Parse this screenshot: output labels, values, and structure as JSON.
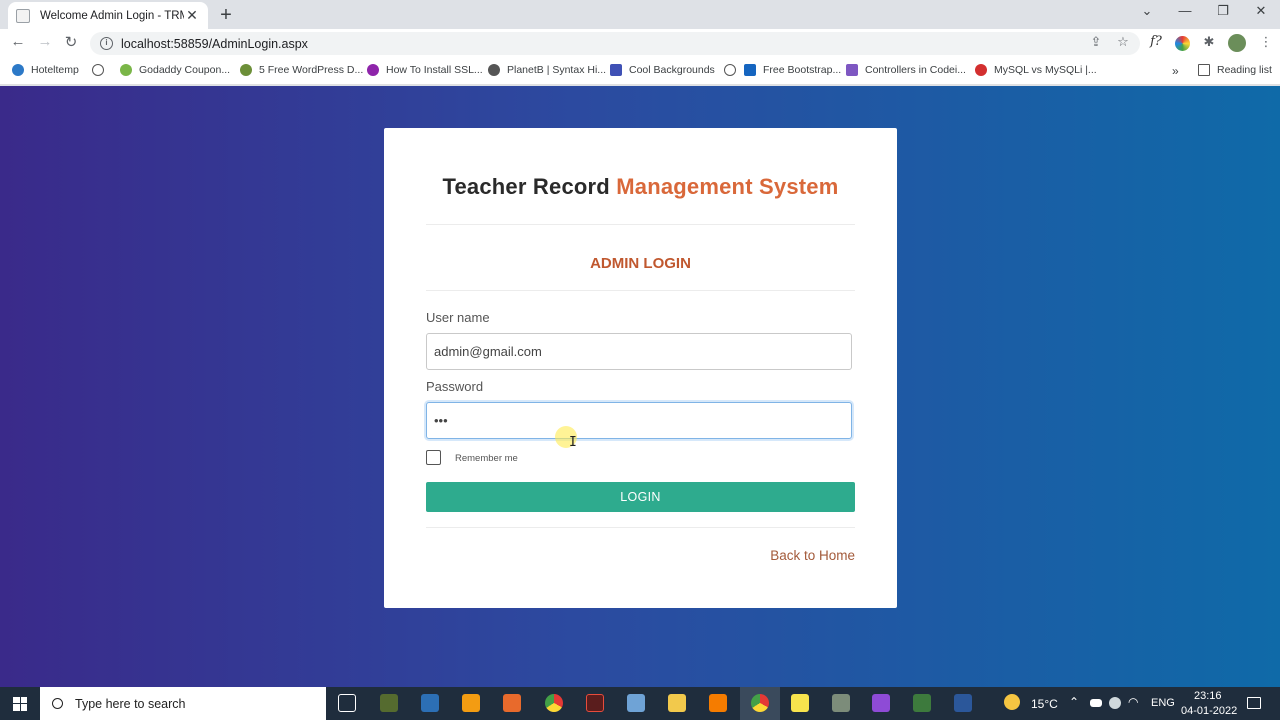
{
  "browser": {
    "tab_title": "Welcome Admin Login - TRMS-",
    "url": "localhost:58859/AdminLogin.aspx",
    "new_tab": "+",
    "close": "✕",
    "controls": {
      "minimize": "—",
      "restore": "❐",
      "close": "✕",
      "tabs_menu": "⌄"
    }
  },
  "bookmarks": [
    {
      "label": "Hoteltemp",
      "color": "#2c79c7"
    },
    {
      "label": "Godaddy Coupon...",
      "color": "#7ab648"
    },
    {
      "label": "5 Free WordPress D...",
      "color": "#6c8f38"
    },
    {
      "label": "How To Install SSL...",
      "color": "#8e24aa"
    },
    {
      "label": "PlanetB | Syntax Hi...",
      "color": "#555555"
    },
    {
      "label": "Cool Backgrounds",
      "color": "#3f51b5"
    },
    {
      "label": "Free Bootstrap...",
      "color": "#1565c0"
    },
    {
      "label": "Controllers in Codei...",
      "color": "#7e57c2"
    },
    {
      "label": "MySQL vs MySQLi |...",
      "color": "#d32f2f"
    }
  ],
  "bookmarks_more": "»",
  "reading_list": "Reading list",
  "card": {
    "brand_part1": "Teacher Record ",
    "brand_part2": "Management System",
    "heading": "ADMIN LOGIN",
    "username_label": "User name",
    "username_value": "admin@gmail.com",
    "password_label": "Password",
    "password_value": "•••",
    "remember_label": "Remember me",
    "login_button": "LOGIN",
    "back_link": "Back to Home"
  },
  "taskbar": {
    "search_placeholder": "Type here to search",
    "temperature": "15°C",
    "language": "ENG",
    "time": "23:16",
    "date": "04-01-2022"
  }
}
